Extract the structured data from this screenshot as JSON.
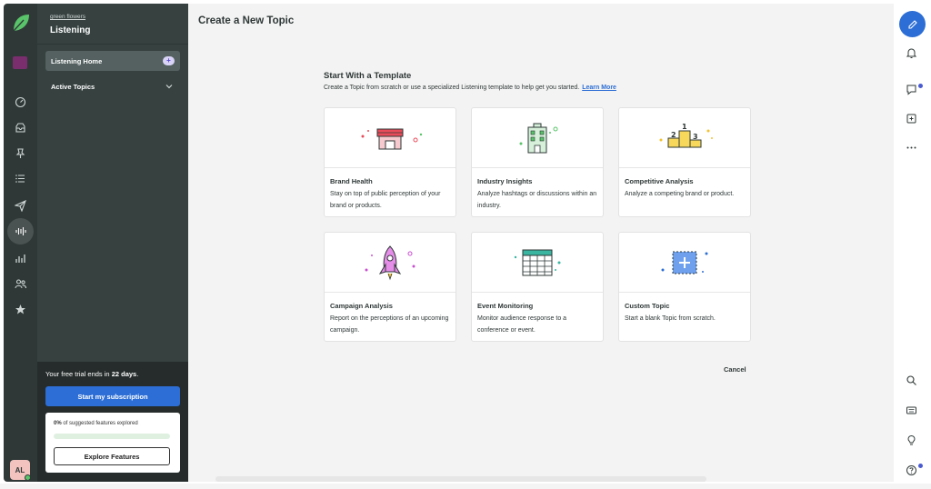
{
  "rail": {
    "items": [
      {
        "name": "dashboard-icon"
      },
      {
        "name": "inbox-icon"
      },
      {
        "name": "pin-icon"
      },
      {
        "name": "list-icon"
      },
      {
        "name": "send-icon"
      },
      {
        "name": "listening-icon",
        "active": true
      },
      {
        "name": "reports-icon"
      },
      {
        "name": "people-icon"
      },
      {
        "name": "star-icon"
      }
    ],
    "avatar": "AL"
  },
  "subnav": {
    "org_name": "green flowers",
    "title": "Listening",
    "items": [
      {
        "label": "Listening Home",
        "badge": "+"
      },
      {
        "label": "Active Topics"
      }
    ],
    "trial": {
      "prefix": "Your free trial ends in ",
      "days": "22 days",
      "suffix": ".",
      "subscribe_label": "Start my subscription",
      "features_percent": "0%",
      "features_text": " of suggested features explored",
      "features_progress": 0.0,
      "explore_label": "Explore Features"
    }
  },
  "main": {
    "title": "Create a New Topic",
    "section_title": "Start With a Template",
    "section_subtitle": "Create a Topic from scratch or use a specialized Listening template to help get you started.",
    "learn_more": "Learn More",
    "cards": [
      {
        "title": "Brand Health",
        "desc": "Stay on top of public perception of your brand or products.",
        "icon": "storefront-icon"
      },
      {
        "title": "Industry Insights",
        "desc": "Analyze hashtags or discussions within an industry.",
        "icon": "building-icon"
      },
      {
        "title": "Competitive Analysis",
        "desc": "Analyze a competing brand or product.",
        "icon": "podium-icon"
      },
      {
        "title": "Campaign Analysis",
        "desc": "Report on the perceptions of an upcoming campaign.",
        "icon": "rocket-icon"
      },
      {
        "title": "Event Monitoring",
        "desc": "Monitor audience response to a conference or event.",
        "icon": "calendar-icon"
      },
      {
        "title": "Custom Topic",
        "desc": "Start a blank Topic from scratch.",
        "icon": "add-box-icon"
      }
    ],
    "cancel_label": "Cancel"
  },
  "right_rail": {
    "items": [
      "compose-icon",
      "bell-icon",
      "chat-icon",
      "add-icon",
      "more-icon",
      "search-icon",
      "keyboard-icon",
      "lightbulb-icon",
      "help-icon"
    ]
  },
  "colors": {
    "rail_bg": "#2f3837",
    "subnav_bg": "#364140",
    "primary": "#2c6ed5",
    "success": "#59c46a"
  }
}
